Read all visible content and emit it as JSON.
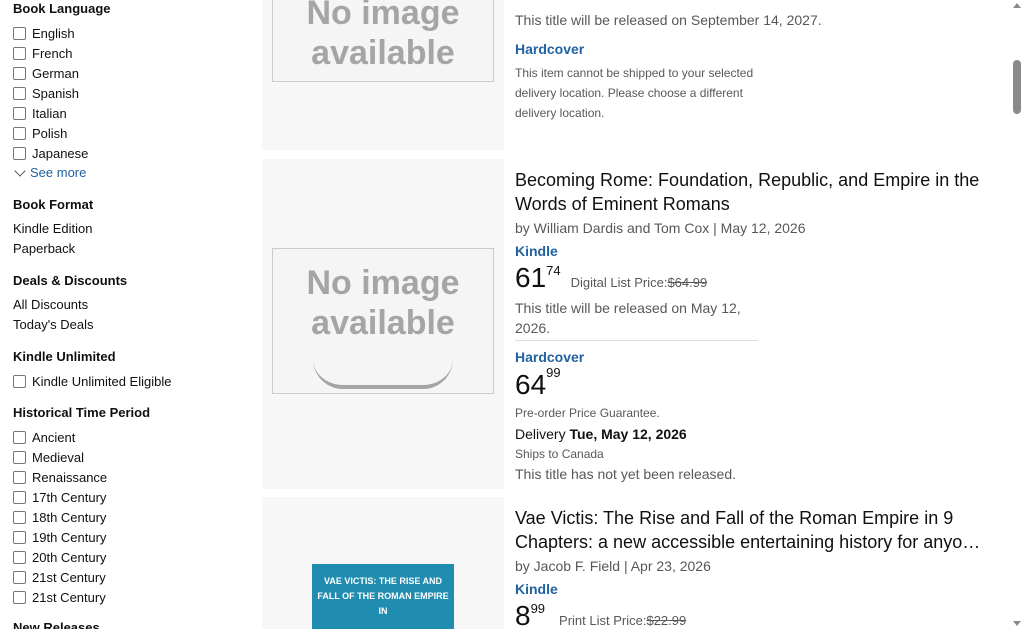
{
  "sidebar": {
    "book_language": {
      "title": "Book Language",
      "items": [
        "English",
        "French",
        "German",
        "Spanish",
        "Italian",
        "Polish",
        "Japanese"
      ],
      "see_more": "See more"
    },
    "book_format": {
      "title": "Book Format",
      "items": [
        "Kindle Edition",
        "Paperback"
      ]
    },
    "deals": {
      "title": "Deals & Discounts",
      "items": [
        "All Discounts",
        "Today's Deals"
      ]
    },
    "kindle_unlimited": {
      "title": "Kindle Unlimited",
      "items": [
        "Kindle Unlimited Eligible"
      ]
    },
    "historical_period": {
      "title": "Historical Time Period",
      "items": [
        "Ancient",
        "Medieval",
        "Renaissance",
        "17th Century",
        "18th Century",
        "19th Century",
        "20th Century",
        "21st Century",
        "21st Century"
      ]
    },
    "new_releases": {
      "title": "New Releases"
    }
  },
  "results": [
    {
      "no_image": "No image available",
      "release_text": "This title will be released on September 14, 2027.",
      "format": "Hardcover",
      "shipping_note": "This item cannot be shipped to your selected delivery location. Please choose a different delivery location."
    },
    {
      "no_image": "No image available",
      "title": "Becoming Rome: Foundation, Republic, and Empire in the Words of Eminent Romans",
      "byline": "by William Dardis and Tom Cox  |  May 12, 2026",
      "format_kindle": "Kindle",
      "kindle_price_whole": "61",
      "kindle_price_frac": "74",
      "digital_list_label": "Digital List Price: ",
      "digital_list_price": "$64.99",
      "kindle_release": "This title will be released on May 12, 2026.",
      "format_hardcover": "Hardcover",
      "hardcover_price_whole": "64",
      "hardcover_price_frac": "99",
      "preorder": "Pre-order Price Guarantee.",
      "delivery_label": "Delivery ",
      "delivery_date": "Tue, May 12, 2026",
      "ships_to": "Ships to Canada",
      "not_released": "This title has not yet been released."
    },
    {
      "cover_text": "VAE VICTIS: THE RISE AND FALL OF THE ROMAN EMPIRE IN",
      "title": "Vae Victis: The Rise and Fall of the Roman Empire in 9 Chapters: a new accessible entertaining history for anyo…",
      "byline": "by Jacob F. Field  |  Apr 23, 2026",
      "format_kindle": "Kindle",
      "price_whole": "8",
      "price_frac": "99",
      "print_list_label": "Print List Price: ",
      "print_list_price": "$22.99"
    }
  ]
}
